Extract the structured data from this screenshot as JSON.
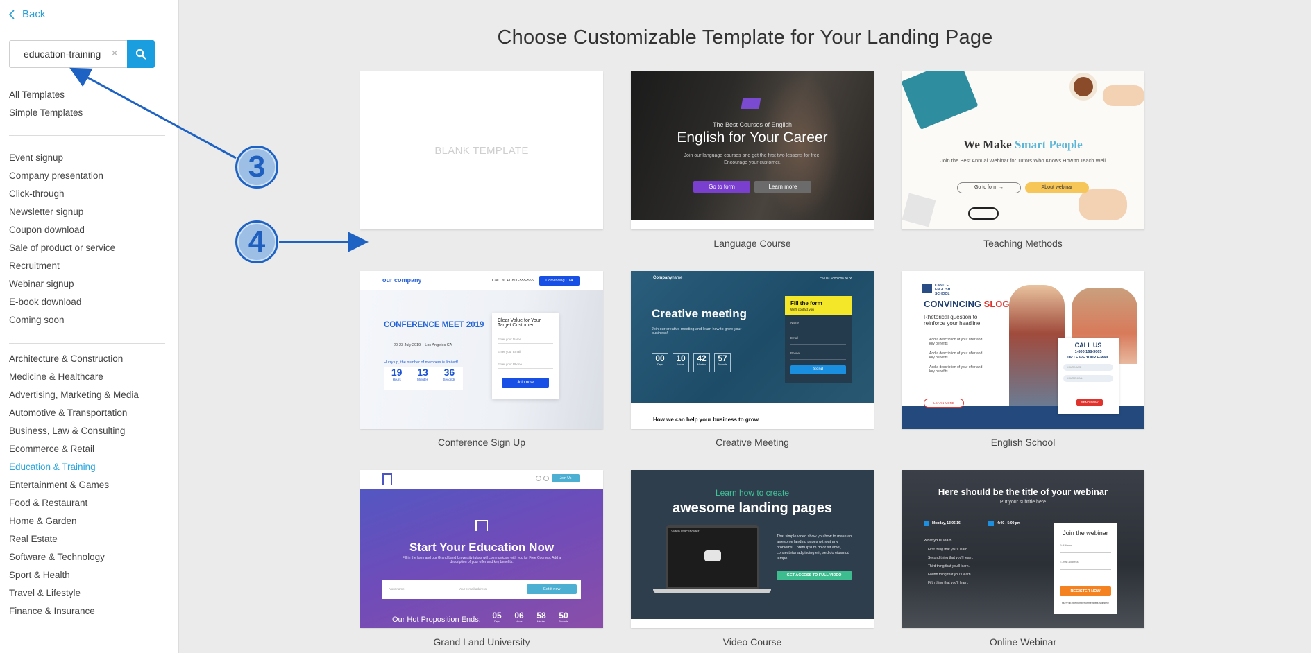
{
  "sidebar": {
    "back_label": "Back",
    "search": {
      "value": "education-training",
      "clear_glyph": "×"
    },
    "top_items": [
      {
        "label": "All Templates"
      },
      {
        "label": "Simple Templates"
      }
    ],
    "type_items": [
      {
        "label": "Event signup"
      },
      {
        "label": "Company presentation"
      },
      {
        "label": "Click-through"
      },
      {
        "label": "Newsletter signup"
      },
      {
        "label": "Coupon download"
      },
      {
        "label": "Sale of product or service"
      },
      {
        "label": "Recruitment"
      },
      {
        "label": "Webinar signup"
      },
      {
        "label": "E-book download"
      },
      {
        "label": "Coming soon"
      }
    ],
    "industry_items": [
      {
        "label": "Architecture & Construction"
      },
      {
        "label": "Medicine & Healthcare"
      },
      {
        "label": "Advertising, Marketing & Media"
      },
      {
        "label": "Automotive & Transportation"
      },
      {
        "label": "Business, Law & Consulting"
      },
      {
        "label": "Ecommerce & Retail"
      },
      {
        "label": "Education & Training",
        "active": true
      },
      {
        "label": "Entertainment & Games"
      },
      {
        "label": "Food & Restaurant"
      },
      {
        "label": "Home & Garden"
      },
      {
        "label": "Real Estate"
      },
      {
        "label": "Software & Technology"
      },
      {
        "label": "Sport & Health"
      },
      {
        "label": "Travel & Lifestyle"
      },
      {
        "label": "Finance & Insurance"
      }
    ]
  },
  "main": {
    "title": "Choose Customizable Template for Your Landing Page",
    "blank_label": "BLANK TEMPLATE",
    "templates": [
      {
        "label": "Language Course"
      },
      {
        "label": "Teaching Methods"
      },
      {
        "label": "Conference Sign Up"
      },
      {
        "label": "Creative Meeting"
      },
      {
        "label": "English School"
      },
      {
        "label": "Grand Land University"
      },
      {
        "label": "Video Course"
      },
      {
        "label": "Online Webinar"
      }
    ]
  },
  "thumbs": {
    "language": {
      "eyebrow": "The Best Courses of English",
      "headline": "English for Your Career",
      "body1": "Join our language courses and get the first two lessons for free.",
      "body2": "Encourage your customer.",
      "btn1": "Go to form",
      "btn2": "Learn more"
    },
    "teaching": {
      "headline_a": "We Make ",
      "headline_b": "Smart People",
      "sub": "Join the Best Annual Webinar for Tutors Who Knows How to Teach Well",
      "btn1": "Go to form →",
      "btn2": "About webinar"
    },
    "conference": {
      "logo": "our company",
      "call": "Call Us: +1 800-555-555",
      "cta": "Convincing CTA",
      "headline": "CONFERENCE MEET 2019",
      "date": "20-23 July 2019 – Los Angeles CA",
      "hurry": "Hurry up, the number of members is limited!",
      "counters": [
        "19",
        "13",
        "36"
      ],
      "units": [
        "Hours",
        "Minutes",
        "Seconds"
      ],
      "form_title": "Clear Value for Your Target Customer",
      "fields": [
        "Enter your Name",
        "Enter your Email",
        "Enter your Phone"
      ],
      "btn": "Join now"
    },
    "creative": {
      "logo_a": "Company",
      "logo_b": "name",
      "call": "Call Us +000 000 00 00",
      "headline": "Creative meeting",
      "body": "Join our creative meeting and learn how to grow your business!",
      "counters": [
        "00",
        "10",
        "42",
        "57"
      ],
      "units": [
        "Days",
        "Hours",
        "Minutes",
        "Seconds"
      ],
      "form_title": "Fill the form",
      "form_sub": "We'll contact you",
      "fields": [
        "Name",
        "Email",
        "Phone"
      ],
      "btn": "Send",
      "footer": "How we can help your business to grow"
    },
    "english": {
      "school": "CASTLE ENGLISH SCHOOL",
      "headline_a": "CONVINCING ",
      "headline_b": "SLOGAN",
      "sub": "Rhetorical question to reinforce your headline",
      "bullet": "Add a description of your offer and key benefits",
      "learn": "LEARN MORE",
      "call": "CALL US",
      "phone": "1-800 168-3065",
      "leave": "OR LEAVE YOUR E-MAIL",
      "fields": [
        "YOUR NAME",
        "YOUR E-MAIL"
      ],
      "send": "SEND NOW"
    },
    "university": {
      "join": "Join Us",
      "headline": "Start Your Education Now",
      "body": "Fill in the form and our Grand Land University tutors will communicate with you for Free Courses. Add a description of your offer and key benefits.",
      "fields": [
        "Your name",
        "Your e-mail address"
      ],
      "btn": "Get it now",
      "ends": "Our Hot Proposition Ends:",
      "counters": [
        "05",
        "06",
        "58",
        "50"
      ],
      "units": [
        "Days",
        "Hours",
        "Minutes",
        "Seconds"
      ]
    },
    "video": {
      "eyebrow": "Learn how to create",
      "headline": "awesome landing pages",
      "placeholder": "Video Placeholder",
      "body": "That simple video show you how to make an awesome landing pages without any problems! Lorem ipsum dolor sit amet, consectetur adipiscing elit, sed do eiusmod tempo.",
      "btn": "GET ACCESS TO FULL VIDEO"
    },
    "webinar": {
      "headline": "Here should be the title of your webinar",
      "sub": "Put your subtitle here",
      "date": "Monday, 13.06.16",
      "time": "4:00 - 5:00 pm",
      "learn": "What you'll learn",
      "items": [
        "First thing that you'll learn.",
        "Second thing that you'll learn.",
        "Third thing that you'll learn.",
        "Fourth thing that you'll learn.",
        "Fifth thing that you'll learn."
      ],
      "form_title": "Join the webinar",
      "fields": [
        "Full Name",
        "E-mail address"
      ],
      "btn": "REGISTER NOW",
      "hurry": "Hurry up, the number of members is limited!"
    }
  },
  "annotations": {
    "badge3": "3",
    "badge4": "4"
  },
  "colors": {
    "accent": "#1a9ee0",
    "active": "#2ba6de",
    "annotation": "#1e63c4"
  }
}
